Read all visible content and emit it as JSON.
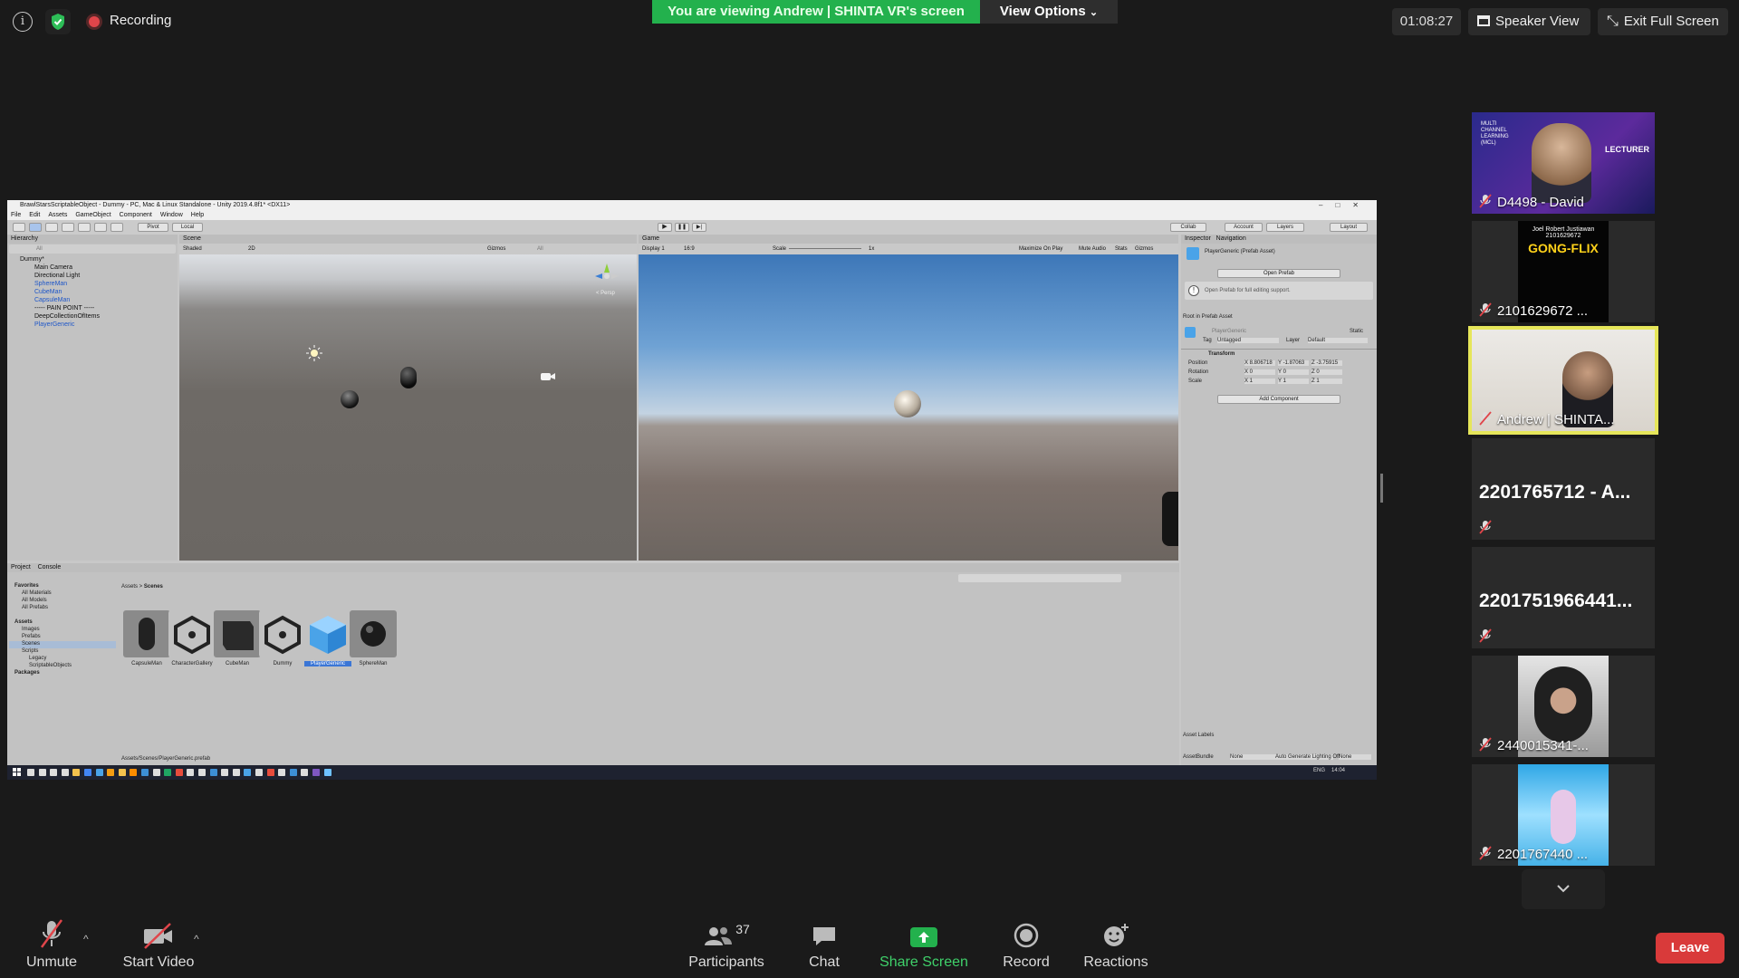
{
  "top": {
    "recording": "Recording",
    "viewing": "You are viewing Andrew | SHINTA VR's screen",
    "view_options": "View Options",
    "timer": "01:08:27",
    "speaker_view": "Speaker View",
    "exit_full_screen": "Exit Full Screen"
  },
  "unity": {
    "window_title": "BrawlStarsScriptableObject - Dummy - PC, Mac & Linux Standalone - Unity 2019.4.8f1* <DX11>",
    "menu": [
      "File",
      "Edit",
      "Assets",
      "GameObject",
      "Component",
      "Window",
      "Help"
    ],
    "toolbar": {
      "pivot": "Pivot",
      "local": "Local",
      "collab": "Collab",
      "account": "Account",
      "layers": "Layers",
      "layout": "Layout"
    },
    "hierarchy": {
      "tab": "Hierarchy",
      "search_placeholder": "All",
      "rows": [
        {
          "label": "Dummy*",
          "blue": false,
          "indent": 0
        },
        {
          "label": "Main Camera",
          "blue": false,
          "indent": 1
        },
        {
          "label": "Directional Light",
          "blue": false,
          "indent": 1
        },
        {
          "label": "SphereMan",
          "blue": true,
          "indent": 1
        },
        {
          "label": "CubeMan",
          "blue": true,
          "indent": 1
        },
        {
          "label": "CapsuleMan",
          "blue": true,
          "indent": 1
        },
        {
          "label": "----- PAIN POINT -----",
          "blue": false,
          "indent": 1
        },
        {
          "label": "DeepCollectionOfItems",
          "blue": false,
          "indent": 1
        },
        {
          "label": "PlayerGeneric",
          "blue": true,
          "indent": 1
        }
      ]
    },
    "scene": {
      "tab": "Scene",
      "shading": "Shaded",
      "mode": "2D",
      "gizmos": "Gizmos",
      "all": "All",
      "persp": "< Persp"
    },
    "game": {
      "tab": "Game",
      "display": "Display 1",
      "aspect": "16:9",
      "scale_label": "Scale",
      "scale_value": "1x",
      "maximize": "Maximize On Play",
      "mute": "Mute Audio",
      "stats": "Stats",
      "gizmos": "Gizmos"
    },
    "inspector": {
      "tab": "Inspector",
      "nav_tab": "Navigation",
      "asset_name": "PlayerGeneric (Prefab Asset)",
      "open_prefab": "Open Prefab",
      "open_prefab_hint": "Open Prefab for full editing support.",
      "root_label": "Root in Prefab Asset",
      "object_name": "PlayerGeneric",
      "static": "Static",
      "tag_label": "Tag",
      "tag_value": "Untagged",
      "layer_label": "Layer",
      "layer_value": "Default",
      "transform": "Transform",
      "position": {
        "label": "Position",
        "x": "8.806718",
        "y": "-1.87063",
        "z": "-3.75915"
      },
      "rotation": {
        "label": "Rotation",
        "x": "0",
        "y": "0",
        "z": "0"
      },
      "scale": {
        "label": "Scale",
        "x": "1",
        "y": "1",
        "z": "1"
      },
      "add_component": "Add Component",
      "asset_labels": "Asset Labels",
      "asset_bundle": "AssetBundle",
      "bundle_value": "None",
      "variant_value": "None"
    },
    "project": {
      "tab": "Project",
      "console_tab": "Console",
      "breadcrumb": [
        "Assets",
        "Scenes"
      ],
      "tree": [
        {
          "label": "Favorites",
          "indent": 0,
          "bold": true
        },
        {
          "label": "All Materials",
          "indent": 1,
          "bold": false
        },
        {
          "label": "All Models",
          "indent": 1,
          "bold": false
        },
        {
          "label": "All Prefabs",
          "indent": 1,
          "bold": false
        },
        {
          "label": "",
          "indent": 0,
          "bold": false
        },
        {
          "label": "Assets",
          "indent": 0,
          "bold": true
        },
        {
          "label": "Images",
          "indent": 1,
          "bold": false
        },
        {
          "label": "Prefabs",
          "indent": 1,
          "bold": false
        },
        {
          "label": "Scenes",
          "indent": 1,
          "bold": false
        },
        {
          "label": "Scripts",
          "indent": 1,
          "bold": false
        },
        {
          "label": "Legacy",
          "indent": 2,
          "bold": false
        },
        {
          "label": "ScriptableObjects",
          "indent": 2,
          "bold": false
        },
        {
          "label": "Packages",
          "indent": 0,
          "bold": true
        }
      ],
      "assets": [
        {
          "name": "CapsuleMan",
          "kind": "capsule"
        },
        {
          "name": "CharacterGallery",
          "kind": "unity"
        },
        {
          "name": "CubeMan",
          "kind": "cube"
        },
        {
          "name": "Dummy",
          "kind": "unity"
        },
        {
          "name": "PlayerGeneric",
          "kind": "prefab"
        },
        {
          "name": "SphereMan",
          "kind": "sphere"
        }
      ],
      "path": "Assets/Scenes/PlayerGeneric.prefab",
      "lighting": "Auto Generate Lighting Off"
    },
    "taskbar": {
      "lang": "ENG",
      "time": "14:04"
    }
  },
  "participants": [
    {
      "name": "D4498 - David",
      "type": "video",
      "style": "david"
    },
    {
      "name": "2101629672 ...",
      "type": "video",
      "style": "gong"
    },
    {
      "name": "Andrew | SHINTA...",
      "type": "video",
      "style": "andrew",
      "active": true
    },
    {
      "name": "2201765712 - A...",
      "type": "name"
    },
    {
      "name": "2201751966441...",
      "type": "name"
    },
    {
      "name": "2440015341-...",
      "type": "video",
      "style": "helmet"
    },
    {
      "name": "2201767440 ...",
      "type": "video",
      "style": "art"
    }
  ],
  "gong_flix": {
    "person": "Joel Robert Justiawan",
    "id": "2101629672",
    "brand": "GONG-FLIX"
  },
  "david_banner": {
    "left": "MULTI CHANNEL LEARNING (MCL)",
    "right": "LECTURER"
  },
  "bottom": {
    "unmute": "Unmute",
    "start_video": "Start Video",
    "participants": "Participants",
    "participants_count": "37",
    "chat": "Chat",
    "share_screen": "Share Screen",
    "record": "Record",
    "reactions": "Reactions",
    "leave": "Leave"
  },
  "colors": {
    "green": "#23b14d",
    "leave": "#d93a3a",
    "active_border": "#e6e65a"
  }
}
